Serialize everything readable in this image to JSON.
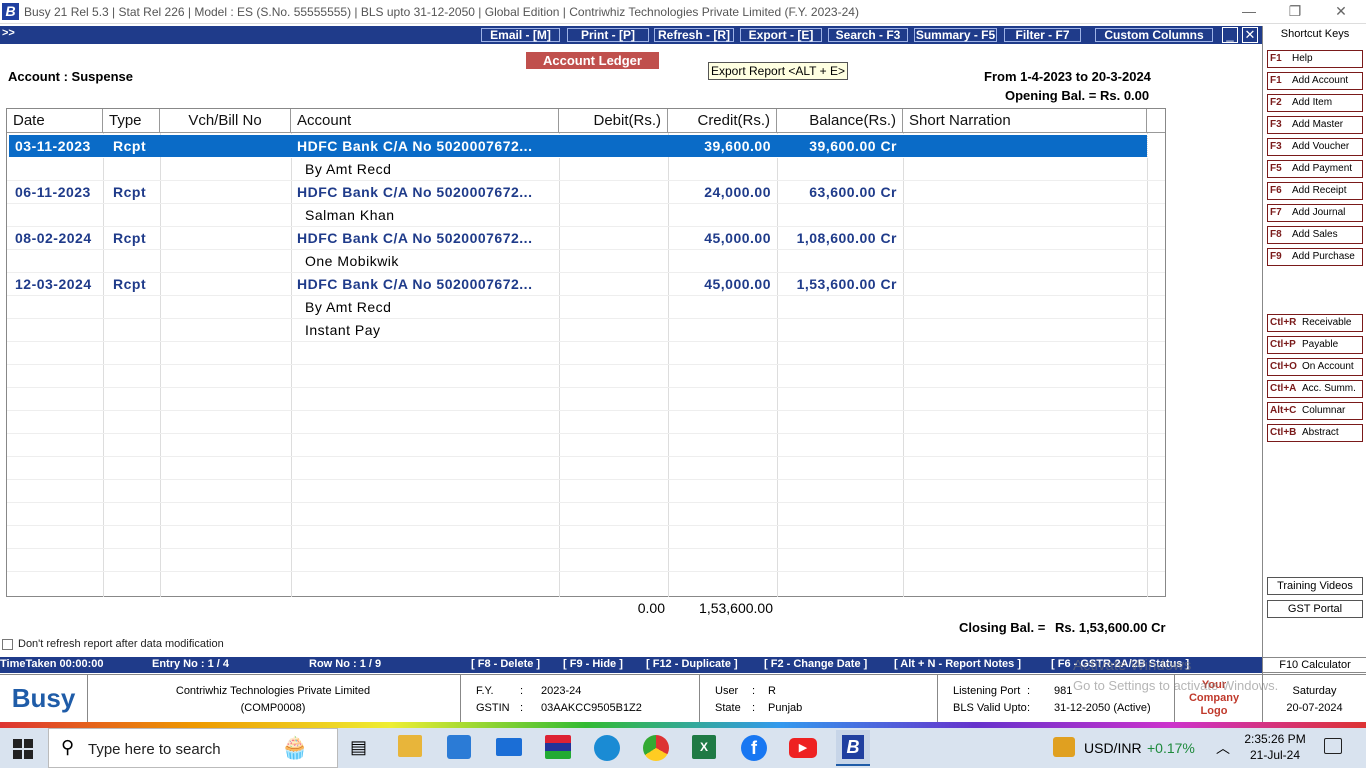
{
  "window": {
    "title": "Busy 21  Rel 5.3  |  Stat Rel 226  |  Model : ES (S.No. 55555555)  |  BLS upto 31-12-2050  |  Global Edition  |  Contriwhiz Technologies Private Limited (F.Y. 2023-24)",
    "logo_letter": "B"
  },
  "toolbar": {
    "expand": ">>",
    "email": "Email - [M]",
    "print": "Print - [P]",
    "refresh": "Refresh - [R]",
    "export": "Export - [E]",
    "search": "Search - F3",
    "summary": "Summary - F5",
    "filter": "Filter - F7",
    "custom_columns": "Custom Columns",
    "minimize": "_",
    "close": "✕"
  },
  "report": {
    "title": "Account Ledger",
    "tooltip": "Export Report <ALT + E>",
    "account": "Account : Suspense",
    "period": "From 1-4-2023 to 20-3-2024",
    "opening": "Opening Bal. = Rs. 0.00",
    "closing_label": "Closing Bal. =",
    "closing_value": "Rs. 1,53,600.00 Cr",
    "total_debit": "0.00",
    "total_credit": "1,53,600.00",
    "refresh_checkbox": "Don't refresh report after data modification"
  },
  "grid": {
    "headers": [
      "Date",
      "Type",
      "Vch/Bill No",
      "Account",
      "Debit(Rs.)",
      "Credit(Rs.)",
      "Balance(Rs.)",
      "Short Narration"
    ],
    "rows": [
      {
        "date": "03-11-2023",
        "type": "Rcpt",
        "account": "HDFC Bank C/A No 5020007672...",
        "credit": "39,600.00",
        "balance": "39,600.00 Cr",
        "sub": "By Amt Recd"
      },
      {
        "date": "06-11-2023",
        "type": "Rcpt",
        "account": "HDFC Bank C/A No 5020007672...",
        "credit": "24,000.00",
        "balance": "63,600.00 Cr",
        "sub": "Salman Khan"
      },
      {
        "date": "08-02-2024",
        "type": "Rcpt",
        "account": "HDFC Bank C/A No 5020007672...",
        "credit": "45,000.00",
        "balance": "1,08,600.00 Cr",
        "sub": "One Mobikwik"
      },
      {
        "date": "12-03-2024",
        "type": "Rcpt",
        "account": "HDFC Bank C/A No 5020007672...",
        "credit": "45,000.00",
        "balance": "1,53,600.00 Cr",
        "sub": "By Amt Recd"
      }
    ],
    "extra_sub": "Instant Pay"
  },
  "shortcuts": {
    "title": "Shortcut Keys",
    "keys": [
      {
        "key": "F1",
        "label": "Help"
      },
      {
        "key": "F1",
        "label": "Add Account"
      },
      {
        "key": "F2",
        "label": "Add Item"
      },
      {
        "key": "F3",
        "label": "Add Master"
      },
      {
        "key": "F3",
        "label": "Add Voucher"
      },
      {
        "key": "F5",
        "label": "Add Payment"
      },
      {
        "key": "F6",
        "label": "Add Receipt"
      },
      {
        "key": "F7",
        "label": "Add Journal"
      },
      {
        "key": "F8",
        "label": "Add Sales"
      },
      {
        "key": "F9",
        "label": "Add Purchase"
      }
    ],
    "ctrl_keys": [
      {
        "key": "Ctl+R",
        "label": "Receivable"
      },
      {
        "key": "Ctl+P",
        "label": "Payable"
      },
      {
        "key": "Ctl+O",
        "label": "On Account"
      },
      {
        "key": "Ctl+A",
        "label": "Acc. Summ."
      },
      {
        "key": "Alt+C",
        "label": "Columnar"
      },
      {
        "key": "Ctl+B",
        "label": "Abstract"
      }
    ],
    "training": "Training Videos",
    "gst": "GST Portal",
    "calculator": "F10 Calculator"
  },
  "status": {
    "time": "TimeTaken 00:00:00",
    "entry": "Entry No : 1 / 4",
    "row": "Row No : 1 / 9",
    "delete": "[ F8 - Delete ]",
    "hide": "[ F9 - Hide ]",
    "duplicate": "[ F12 - Duplicate ]",
    "change_date": "[ F2 - Change Date ]",
    "notes": "[ Alt + N - Report Notes ]",
    "gstr": "[ F6 - GSTR-2A/2B Status ]"
  },
  "info": {
    "brand": "Busy",
    "company": "Contriwhiz Technologies Private Limited",
    "code": "(COMP0008)",
    "fy_label": "F.Y.",
    "fy": "2023-24",
    "gstin_label": "GSTIN",
    "gstin": "03AAKCC9505B1Z2",
    "user_label": "User",
    "user": "R",
    "state_label": "State",
    "state": "Punjab",
    "port_label": "Listening Port",
    "port": "981",
    "bls_label": "BLS Valid Upto",
    "bls": "31-12-2050 (Active)",
    "logo_text": "Your Company Logo",
    "day": "Saturday",
    "date": "20-07-2024",
    "watermark1": "Activate Windows",
    "watermark2": "Go to Settings to activate Windows."
  },
  "taskbar": {
    "search": "Type here to search",
    "currency": "USD/INR",
    "change": "+0.17%",
    "time": "2:35:26 PM",
    "date": "21-Jul-24"
  }
}
